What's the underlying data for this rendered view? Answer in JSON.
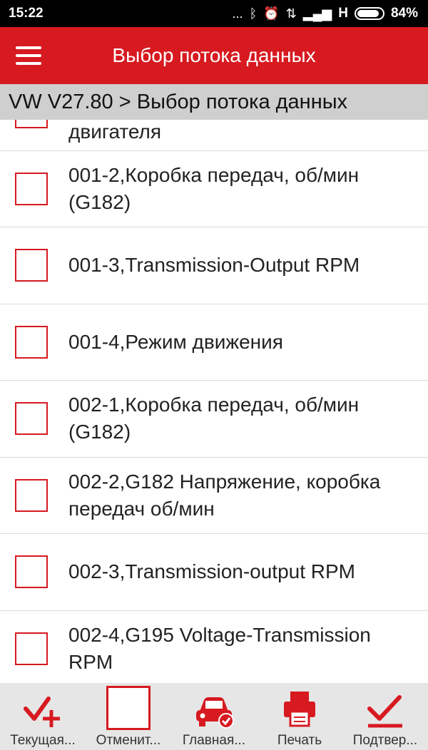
{
  "status_bar": {
    "time": "15:22",
    "dots": "...",
    "network": "H",
    "battery": "84%",
    "icons": [
      "bluetooth-icon",
      "alarm-icon",
      "vibrate-icon",
      "signal-icon",
      "battery-icon"
    ]
  },
  "app_bar": {
    "title": "Выбор потока данных",
    "menu_icon": "hamburger-icon"
  },
  "breadcrumb": "VW V27.80 > Выбор потока данных",
  "list": {
    "items": [
      {
        "label": "двигателя",
        "checked": false
      },
      {
        "label": "001-2,Коробка передач, об/мин (G182)",
        "checked": false
      },
      {
        "label": "001-3,Transmission-Output RPM",
        "checked": false
      },
      {
        "label": "001-4,Режим движения",
        "checked": false
      },
      {
        "label": "002-1,Коробка передач, об/мин (G182)",
        "checked": false
      },
      {
        "label": "002-2,G182 Напряжение, коробка передач об/мин",
        "checked": false
      },
      {
        "label": "002-3,Transmission-output RPM",
        "checked": false
      },
      {
        "label": "002-4,G195 Voltage-Transmission RPM",
        "checked": false
      }
    ]
  },
  "bottom_bar": {
    "accent": "#d71920",
    "tabs": [
      {
        "label": "Текущая...",
        "icon": "check-plus-icon"
      },
      {
        "label": "Отменит...",
        "icon": "empty-checkbox-icon"
      },
      {
        "label": "Главная...",
        "icon": "car-check-icon"
      },
      {
        "label": "Печать",
        "icon": "printer-icon"
      },
      {
        "label": "Подтвер...",
        "icon": "confirm-check-icon"
      }
    ]
  }
}
